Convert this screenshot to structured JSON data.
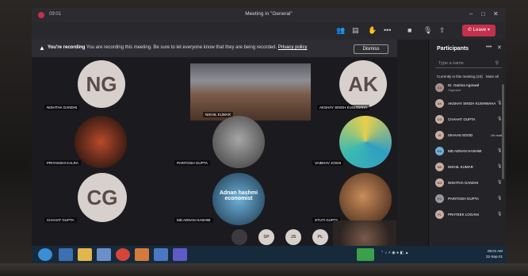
{
  "window": {
    "title": "Meeting in \"General\"",
    "timer": "09:01"
  },
  "toolbar": {
    "leave_label": "Leave",
    "more_icon": "•••"
  },
  "recording_banner": {
    "bold": "You're recording",
    "text": "You are recording this meeting. Be sure to let everyone know that they are being recorded.",
    "link": "Privacy policy",
    "dismiss_label": "Dismiss"
  },
  "stage": {
    "tiles": [
      {
        "name": "NISHTHA GANDHI",
        "initials": "NG"
      },
      {
        "name": "NIKHIL KUMAR",
        "initials": ""
      },
      {
        "name": "AKSHAY SINGH KUSHWAHA",
        "initials": "AK"
      },
      {
        "name": "PRIYANSHI KALRA",
        "initials": ""
      },
      {
        "name": "PARITOSH GUPTA",
        "initials": ""
      },
      {
        "name": "VAIBHAV JOSHI",
        "initials": ""
      },
      {
        "name": "CHAHAT GUPTA",
        "initials": "CG"
      },
      {
        "name": "MD ADNAN HASHMI",
        "initials": "",
        "overlay": "Adnan hashmi economist"
      },
      {
        "name": "STUTI GUPTA",
        "initials": ""
      }
    ],
    "overflow": [
      "SP",
      "JS",
      "PL",
      "YA"
    ]
  },
  "participants_panel": {
    "title": "Participants",
    "search_placeholder": "Type a name",
    "section_label": "Currently in this meeting (23)",
    "mute_all": "Mute all",
    "organizer_label": "Organizer",
    "on_hold": "On hold",
    "people": [
      {
        "name": "Dr. Garima Agarwal",
        "initials": "GA"
      },
      {
        "name": "AKSHAY SINGH KUSHWAHA",
        "initials": "AK"
      },
      {
        "name": "CHAHAT GUPTA",
        "initials": "CG"
      },
      {
        "name": "ISHAAN SOOD",
        "initials": "IS"
      },
      {
        "name": "MD ADNAN HASHMI",
        "initials": "MA"
      },
      {
        "name": "NIKHIL KUMAR",
        "initials": "NK"
      },
      {
        "name": "NISHTHA GANDHI",
        "initials": "NG"
      },
      {
        "name": "PARITOSH GUPTA",
        "initials": "PG"
      },
      {
        "name": "PRATEEK LOGANI",
        "initials": "PL"
      }
    ]
  },
  "taskbar": {
    "time": "09:01 AM",
    "date": "22-Sep-21"
  }
}
